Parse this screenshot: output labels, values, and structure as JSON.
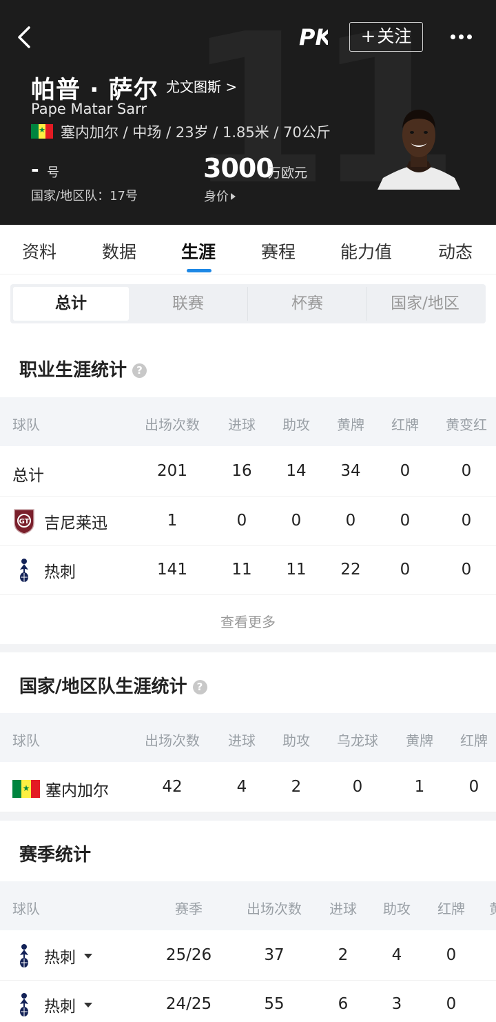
{
  "header": {
    "bg_number": "11",
    "name": "帕普 · 萨尔",
    "club": "尤文图斯 >",
    "english_name": "Pape Matar Sarr",
    "info": "塞内加尔 / 中场 / 23岁 / 1.85米 / 70公斤",
    "shirt_number": "-",
    "shirt_unit": "号",
    "national_number": "国家/地区队：17号",
    "market_value": "3000",
    "market_value_unit": "万欧元",
    "market_value_label": "身价",
    "follow_label": "关注",
    "logo_text": "PK"
  },
  "tabs": [
    "资料",
    "数据",
    "生涯",
    "赛程",
    "能力值",
    "动态"
  ],
  "active_tab": "生涯",
  "segments": [
    "总计",
    "联赛",
    "杯赛",
    "国家/地区"
  ],
  "career": {
    "title": "职业生涯统计",
    "help": "?",
    "headers": [
      "球队",
      "出场次数",
      "进球",
      "助攻",
      "黄牌",
      "红牌",
      "黄变红"
    ],
    "rows": [
      {
        "team": "总计",
        "values": [
          "201",
          "16",
          "14",
          "34",
          "0",
          "0"
        ]
      },
      {
        "team": "吉尼莱迅",
        "values": [
          "1",
          "0",
          "0",
          "0",
          "0",
          "0"
        ]
      },
      {
        "team": "热刺",
        "values": [
          "141",
          "11",
          "11",
          "22",
          "0",
          "0"
        ]
      }
    ],
    "view_more": "查看更多"
  },
  "national": {
    "title": "国家/地区队生涯统计",
    "help": "?",
    "headers": [
      "球队",
      "出场次数",
      "进球",
      "助攻",
      "乌龙球",
      "黄牌",
      "红牌"
    ],
    "rows": [
      {
        "team": "塞内加尔",
        "values": [
          "42",
          "4",
          "2",
          "0",
          "1",
          "0"
        ]
      }
    ]
  },
  "season": {
    "title": "赛季统计",
    "headers": [
      "球队",
      "赛季",
      "出场次数",
      "进球",
      "助攻",
      "红牌",
      "黄"
    ],
    "rows": [
      {
        "team": "热刺",
        "values": [
          "25/26",
          "37",
          "2",
          "4",
          "0"
        ]
      },
      {
        "team": "热刺",
        "values": [
          "24/25",
          "55",
          "6",
          "3",
          "0"
        ]
      }
    ]
  },
  "colors": {
    "header_bg": "#1c1c1c",
    "accent": "#1e88e5",
    "table_header_bg": "#f3f5f8"
  }
}
